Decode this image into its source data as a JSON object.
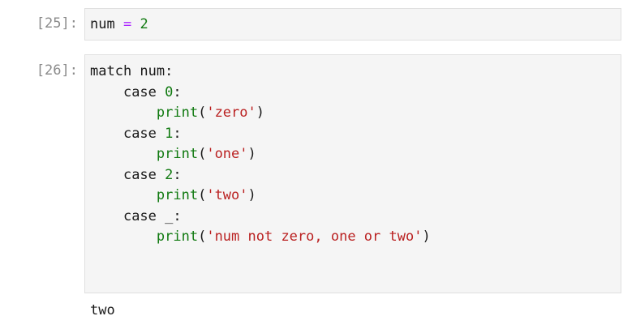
{
  "cells": [
    {
      "prompt": "[25]:",
      "lines": [
        [
          {
            "t": "num ",
            "c": "plain"
          },
          {
            "t": "=",
            "c": "op"
          },
          {
            "t": " ",
            "c": "plain"
          },
          {
            "t": "2",
            "c": "num"
          }
        ]
      ]
    },
    {
      "prompt": "[26]:",
      "lines": [
        [
          {
            "t": "match",
            "c": "kw"
          },
          {
            "t": " num:",
            "c": "plain"
          }
        ],
        [
          {
            "t": "    ",
            "c": "plain"
          },
          {
            "t": "case",
            "c": "kw"
          },
          {
            "t": " ",
            "c": "plain"
          },
          {
            "t": "0",
            "c": "num"
          },
          {
            "t": ":",
            "c": "plain"
          }
        ],
        [
          {
            "t": "        ",
            "c": "plain"
          },
          {
            "t": "print",
            "c": "builtin"
          },
          {
            "t": "(",
            "c": "plain"
          },
          {
            "t": "'zero'",
            "c": "str"
          },
          {
            "t": ")",
            "c": "plain"
          }
        ],
        [
          {
            "t": "    ",
            "c": "plain"
          },
          {
            "t": "case",
            "c": "kw"
          },
          {
            "t": " ",
            "c": "plain"
          },
          {
            "t": "1",
            "c": "num"
          },
          {
            "t": ":",
            "c": "plain"
          }
        ],
        [
          {
            "t": "        ",
            "c": "plain"
          },
          {
            "t": "print",
            "c": "builtin"
          },
          {
            "t": "(",
            "c": "plain"
          },
          {
            "t": "'one'",
            "c": "str"
          },
          {
            "t": ")",
            "c": "plain"
          }
        ],
        [
          {
            "t": "    ",
            "c": "plain"
          },
          {
            "t": "case",
            "c": "kw"
          },
          {
            "t": " ",
            "c": "plain"
          },
          {
            "t": "2",
            "c": "num"
          },
          {
            "t": ":",
            "c": "plain"
          }
        ],
        [
          {
            "t": "        ",
            "c": "plain"
          },
          {
            "t": "print",
            "c": "builtin"
          },
          {
            "t": "(",
            "c": "plain"
          },
          {
            "t": "'two'",
            "c": "str"
          },
          {
            "t": ")",
            "c": "plain"
          }
        ],
        [
          {
            "t": "    ",
            "c": "plain"
          },
          {
            "t": "case",
            "c": "kw"
          },
          {
            "t": " _:",
            "c": "plain"
          }
        ],
        [
          {
            "t": "        ",
            "c": "plain"
          },
          {
            "t": "print",
            "c": "builtin"
          },
          {
            "t": "(",
            "c": "plain"
          },
          {
            "t": "'num not zero, one or two'",
            "c": "str"
          },
          {
            "t": ")",
            "c": "plain"
          }
        ]
      ],
      "output": "two"
    }
  ],
  "colors": {
    "keyword": "#1a1a1a",
    "number": "#117a11",
    "operator": "#aa22ff",
    "builtin": "#117a11",
    "string": "#ba2121",
    "prompt": "#8a8a8a",
    "cell_background": "#f5f5f5",
    "cell_border": "#e0e0e0"
  }
}
